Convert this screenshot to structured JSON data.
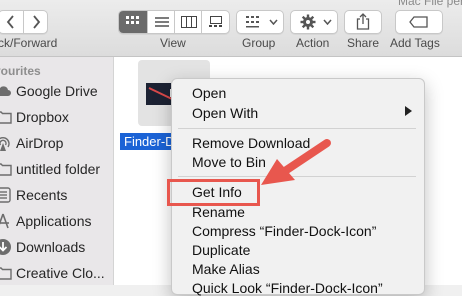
{
  "window": {
    "title_fragment": "Mac File perm"
  },
  "toolbar": {
    "nav_label": "ck/Forward",
    "view_label": "View",
    "group_label": "Group",
    "action_label": "Action",
    "share_label": "Share",
    "tags_label": "Add Tags"
  },
  "sidebar": {
    "heading": "vourites",
    "items": [
      {
        "label": "Google Drive",
        "icon": "cloud-icon"
      },
      {
        "label": "Dropbox",
        "icon": "folder-icon"
      },
      {
        "label": "AirDrop",
        "icon": "airdrop-icon"
      },
      {
        "label": "untitled folder",
        "icon": "folder-icon"
      },
      {
        "label": "Recents",
        "icon": "clock-icon"
      },
      {
        "label": "Applications",
        "icon": "applications-icon"
      },
      {
        "label": "Downloads",
        "icon": "download-icon"
      },
      {
        "label": "Creative Clo...",
        "icon": "folder-icon"
      }
    ]
  },
  "file": {
    "name": "Finder-D"
  },
  "menu": {
    "items": [
      {
        "label": "Open"
      },
      {
        "label": "Open With"
      },
      {
        "label": "Remove Download"
      },
      {
        "label": "Move to Bin"
      },
      {
        "label": "Get Info"
      },
      {
        "label": "Rename"
      },
      {
        "label": "Compress “Finder-Dock-Icon”"
      },
      {
        "label": "Duplicate"
      },
      {
        "label": "Make Alias"
      },
      {
        "label": "Quick Look “Finder-Dock-Icon”"
      }
    ]
  },
  "colors": {
    "highlight": "#e8574e",
    "selection": "#1b63d6",
    "sidebar_icon": "#6d6d6d"
  }
}
